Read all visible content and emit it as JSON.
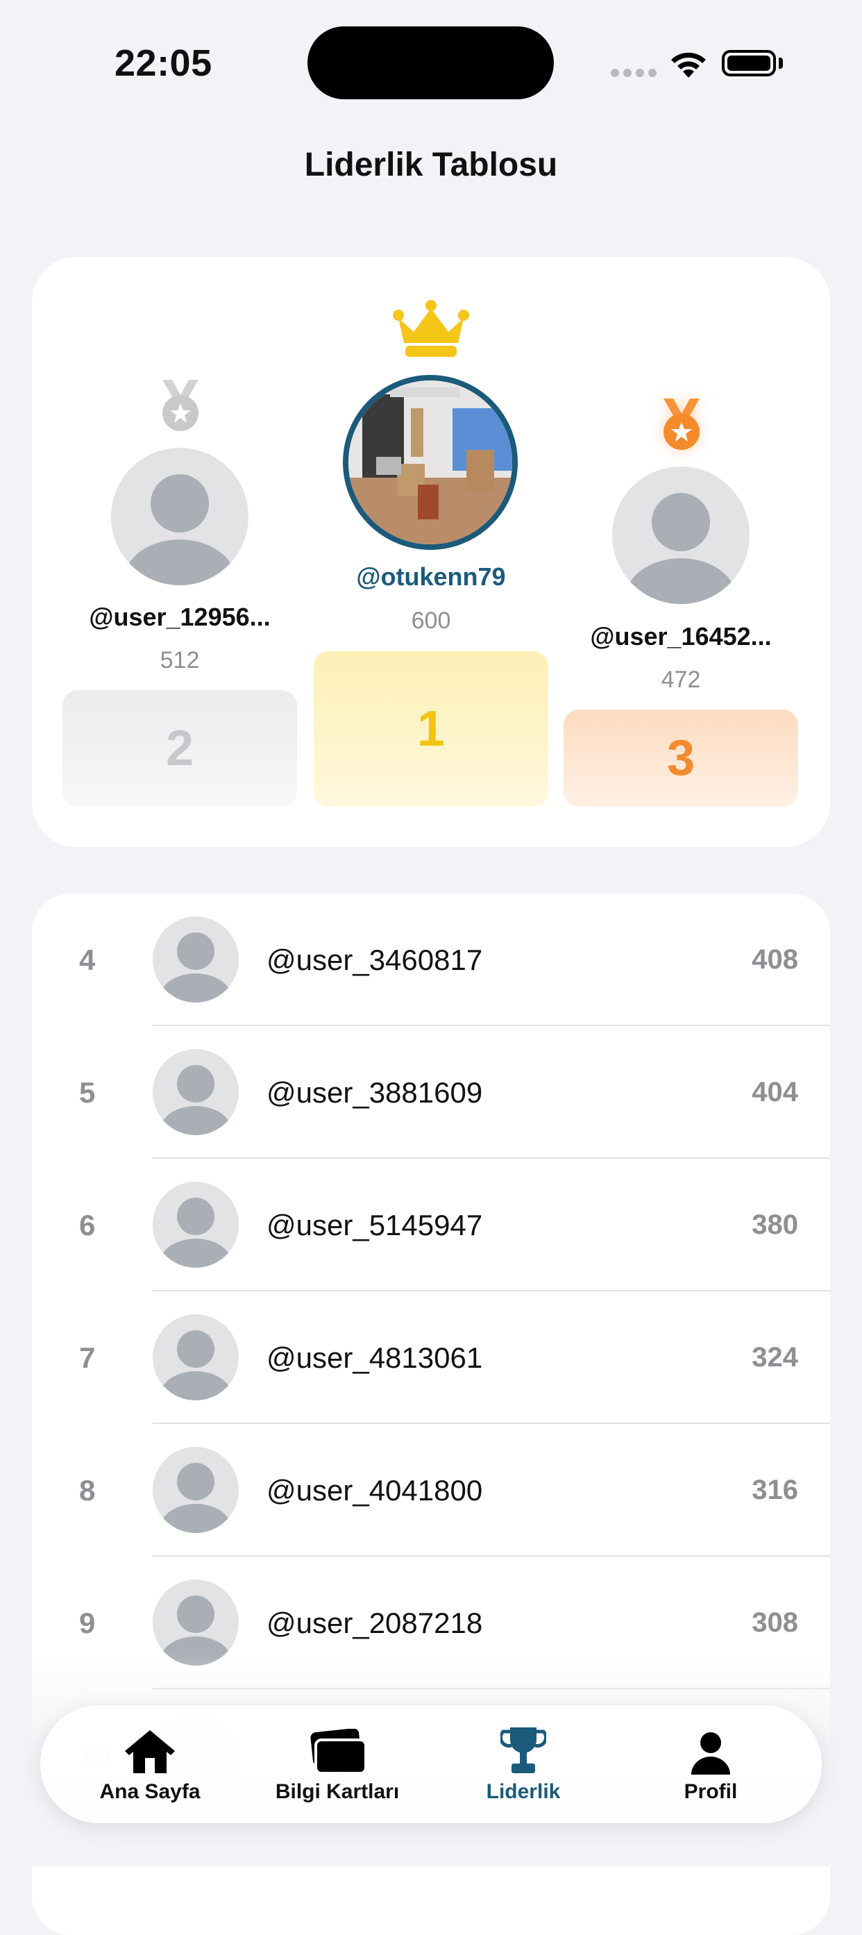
{
  "status_bar": {
    "time": "22:05"
  },
  "header": {
    "title": "Liderlik Tablosu"
  },
  "podium": {
    "first": {
      "username": "@otukenn79",
      "score": "600",
      "rank": "1"
    },
    "second": {
      "username": "@user_12956...",
      "score": "512",
      "rank": "2"
    },
    "third": {
      "username": "@user_16452...",
      "score": "472",
      "rank": "3"
    }
  },
  "leaderboard": {
    "rows": [
      {
        "rank": "4",
        "username": "@user_3460817",
        "score": "408"
      },
      {
        "rank": "5",
        "username": "@user_3881609",
        "score": "404"
      },
      {
        "rank": "6",
        "username": "@user_5145947",
        "score": "380"
      },
      {
        "rank": "7",
        "username": "@user_4813061",
        "score": "324"
      },
      {
        "rank": "8",
        "username": "@user_4041800",
        "score": "316"
      },
      {
        "rank": "9",
        "username": "@user_2087218",
        "score": "308"
      },
      {
        "rank": "10",
        "username": "",
        "score": ""
      }
    ]
  },
  "tabbar": {
    "tabs": [
      {
        "label": "Ana Sayfa",
        "icon": "house-icon"
      },
      {
        "label": "Bilgi Kartları",
        "icon": "cards-icon"
      },
      {
        "label": "Liderlik",
        "icon": "trophy-icon",
        "active": true
      },
      {
        "label": "Profil",
        "icon": "person-icon"
      }
    ]
  },
  "colors": {
    "accent": "#1b5a7a",
    "gold": "#f5c518",
    "silver": "#c6c6c9",
    "bronze": "#f58a2c",
    "background": "#f2f2f7"
  }
}
